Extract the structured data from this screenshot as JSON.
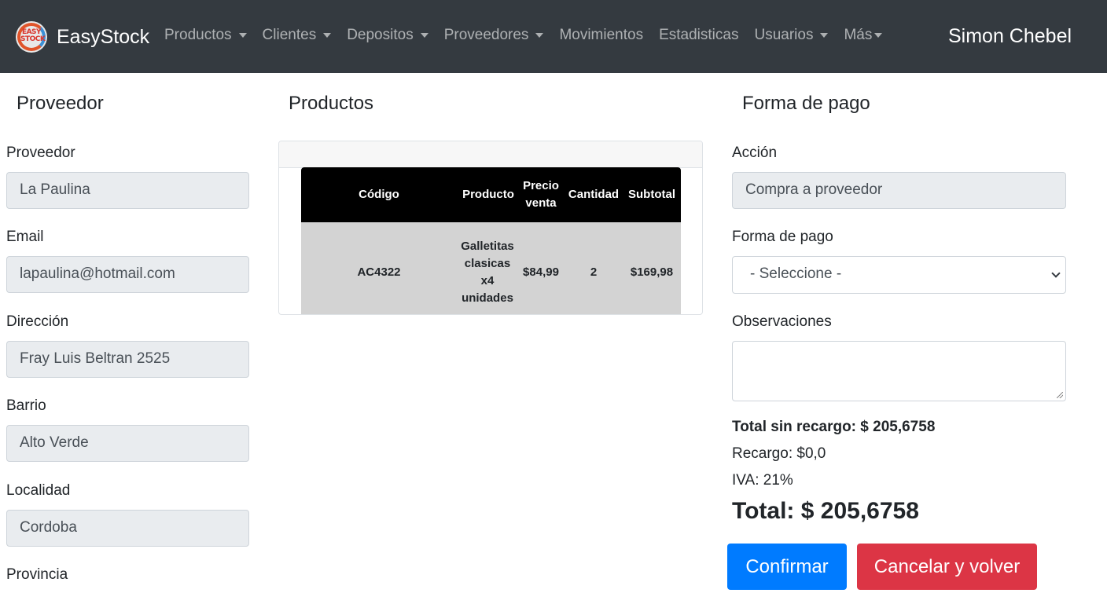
{
  "navbar": {
    "logo_text": "EASY STOCK",
    "brand": "EasyStock",
    "items": [
      {
        "label": "Productos",
        "dropdown": true
      },
      {
        "label": "Clientes",
        "dropdown": true
      },
      {
        "label": "Depositos",
        "dropdown": true
      },
      {
        "label": "Proveedores",
        "dropdown": true
      },
      {
        "label": "Movimientos",
        "dropdown": false
      },
      {
        "label": "Estadisticas",
        "dropdown": false
      },
      {
        "label": "Usuarios",
        "dropdown": true
      },
      {
        "label": "Más",
        "dropdown": true
      }
    ],
    "user": "Simon Chebel"
  },
  "proveedor": {
    "title": "Proveedor",
    "fields": [
      {
        "label": "Proveedor",
        "value": "La Paulina"
      },
      {
        "label": "Email",
        "value": "lapaulina@hotmail.com"
      },
      {
        "label": "Dirección",
        "value": "Fray Luis Beltran 2525"
      },
      {
        "label": "Barrio",
        "value": "Alto Verde"
      },
      {
        "label": "Localidad",
        "value": "Cordoba"
      },
      {
        "label": "Provincia",
        "value": ""
      }
    ]
  },
  "productos": {
    "title": "Productos",
    "columns": [
      "Código",
      "Producto",
      "Precio venta",
      "Cantidad",
      "Subtotal"
    ],
    "rows": [
      {
        "codigo": "AC4322",
        "producto": "Galletitas clasicas x4 unidades",
        "precio": "$84,99",
        "cantidad": "2",
        "subtotal": "$169,98"
      }
    ]
  },
  "pago": {
    "title": "Forma de pago",
    "accion_label": "Acción",
    "accion_value": "Compra a proveedor",
    "forma_label": "Forma de pago",
    "forma_value": "- Seleccione -",
    "obs_label": "Observaciones",
    "obs_value": "",
    "total_sin_recargo": "Total sin recargo: $ 205,6758",
    "recargo": "Recargo: $0,0",
    "iva": "IVA: 21%",
    "total": "Total: $ 205,6758"
  },
  "buttons": {
    "confirm": "Confirmar",
    "cancel": "Cancelar y volver"
  },
  "colors": {
    "navbar": "#343a40",
    "primary": "#007bff",
    "danger": "#dc3545",
    "table_header": "#000000",
    "table_row": "#d3d3d3"
  }
}
